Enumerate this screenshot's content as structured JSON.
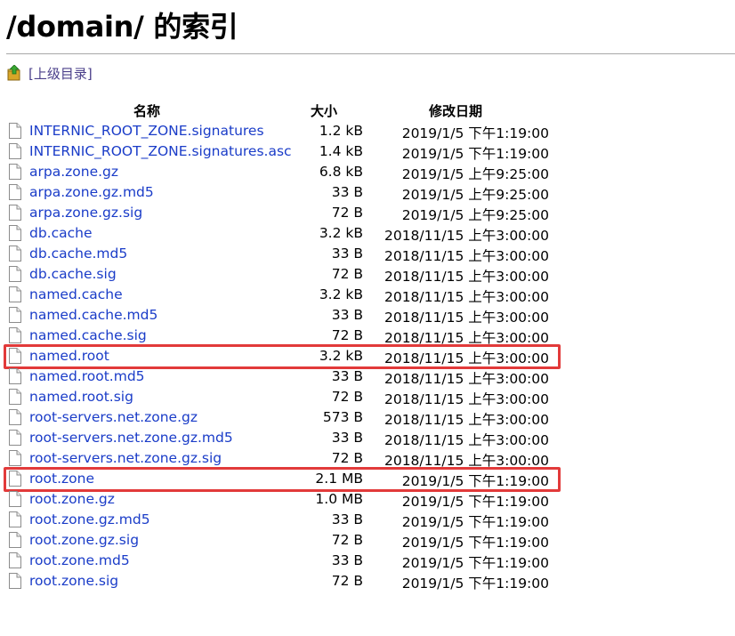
{
  "title": "/domain/ 的索引",
  "parent_link": "[上级目录]",
  "columns": {
    "name": "名称",
    "size": "大小",
    "modified": "修改日期"
  },
  "highlight_color": "#e23a3a",
  "link_color": "#1a3cc8",
  "files": [
    {
      "name": "INTERNIC_ROOT_ZONE.signatures",
      "size": "1.2 kB",
      "modified": "2019/1/5 下午1:19:00",
      "highlighted": false,
      "icon": "file-icon"
    },
    {
      "name": "INTERNIC_ROOT_ZONE.signatures.asc",
      "size": "1.4 kB",
      "modified": "2019/1/5 下午1:19:00",
      "highlighted": false,
      "icon": "file-icon"
    },
    {
      "name": "arpa.zone.gz",
      "size": "6.8 kB",
      "modified": "2019/1/5 上午9:25:00",
      "highlighted": false,
      "icon": "file-icon"
    },
    {
      "name": "arpa.zone.gz.md5",
      "size": "33 B",
      "modified": "2019/1/5 上午9:25:00",
      "highlighted": false,
      "icon": "file-icon"
    },
    {
      "name": "arpa.zone.gz.sig",
      "size": "72 B",
      "modified": "2019/1/5 上午9:25:00",
      "highlighted": false,
      "icon": "file-icon"
    },
    {
      "name": "db.cache",
      "size": "3.2 kB",
      "modified": "2018/11/15 上午3:00:00",
      "highlighted": false,
      "icon": "file-icon"
    },
    {
      "name": "db.cache.md5",
      "size": "33 B",
      "modified": "2018/11/15 上午3:00:00",
      "highlighted": false,
      "icon": "file-icon"
    },
    {
      "name": "db.cache.sig",
      "size": "72 B",
      "modified": "2018/11/15 上午3:00:00",
      "highlighted": false,
      "icon": "file-icon"
    },
    {
      "name": "named.cache",
      "size": "3.2 kB",
      "modified": "2018/11/15 上午3:00:00",
      "highlighted": false,
      "icon": "file-icon"
    },
    {
      "name": "named.cache.md5",
      "size": "33 B",
      "modified": "2018/11/15 上午3:00:00",
      "highlighted": false,
      "icon": "file-icon"
    },
    {
      "name": "named.cache.sig",
      "size": "72 B",
      "modified": "2018/11/15 上午3:00:00",
      "highlighted": false,
      "icon": "file-icon"
    },
    {
      "name": "named.root",
      "size": "3.2 kB",
      "modified": "2018/11/15 上午3:00:00",
      "highlighted": true,
      "icon": "file-icon"
    },
    {
      "name": "named.root.md5",
      "size": "33 B",
      "modified": "2018/11/15 上午3:00:00",
      "highlighted": false,
      "icon": "file-icon"
    },
    {
      "name": "named.root.sig",
      "size": "72 B",
      "modified": "2018/11/15 上午3:00:00",
      "highlighted": false,
      "icon": "file-icon"
    },
    {
      "name": "root-servers.net.zone.gz",
      "size": "573 B",
      "modified": "2018/11/15 上午3:00:00",
      "highlighted": false,
      "icon": "file-icon"
    },
    {
      "name": "root-servers.net.zone.gz.md5",
      "size": "33 B",
      "modified": "2018/11/15 上午3:00:00",
      "highlighted": false,
      "icon": "file-icon"
    },
    {
      "name": "root-servers.net.zone.gz.sig",
      "size": "72 B",
      "modified": "2018/11/15 上午3:00:00",
      "highlighted": false,
      "icon": "file-icon"
    },
    {
      "name": "root.zone",
      "size": "2.1 MB",
      "modified": "2019/1/5 下午1:19:00",
      "highlighted": true,
      "icon": "file-icon"
    },
    {
      "name": "root.zone.gz",
      "size": "1.0 MB",
      "modified": "2019/1/5 下午1:19:00",
      "highlighted": false,
      "icon": "file-icon"
    },
    {
      "name": "root.zone.gz.md5",
      "size": "33 B",
      "modified": "2019/1/5 下午1:19:00",
      "highlighted": false,
      "icon": "file-icon"
    },
    {
      "name": "root.zone.gz.sig",
      "size": "72 B",
      "modified": "2019/1/5 下午1:19:00",
      "highlighted": false,
      "icon": "file-icon"
    },
    {
      "name": "root.zone.md5",
      "size": "33 B",
      "modified": "2019/1/5 下午1:19:00",
      "highlighted": false,
      "icon": "file-icon"
    },
    {
      "name": "root.zone.sig",
      "size": "72 B",
      "modified": "2019/1/5 下午1:19:00",
      "highlighted": false,
      "icon": "file-icon"
    }
  ]
}
